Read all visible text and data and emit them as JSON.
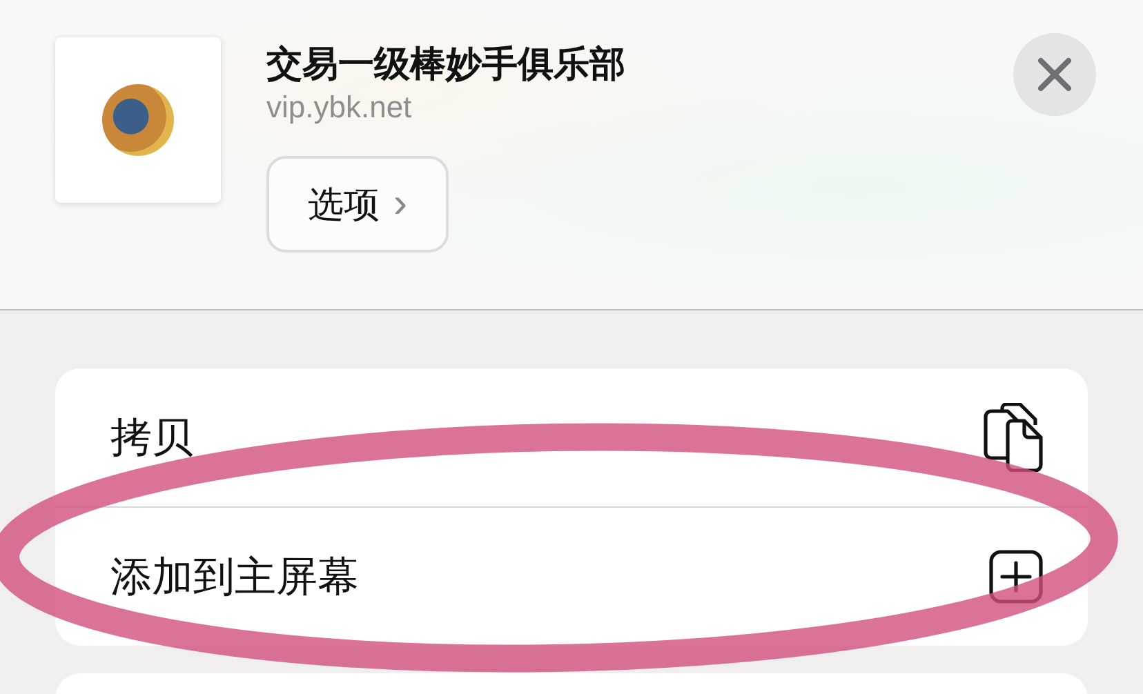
{
  "header": {
    "title": "交易一级棒妙手俱乐部",
    "url": "vip.ybk.net",
    "options_button": {
      "label": "选项",
      "chevron": "›"
    }
  },
  "actions": [
    {
      "label": "拷贝",
      "kind": "copy"
    },
    {
      "label": "添加到主屏幕",
      "kind": "add"
    }
  ],
  "annotation": {
    "kind": "ellipse"
  }
}
